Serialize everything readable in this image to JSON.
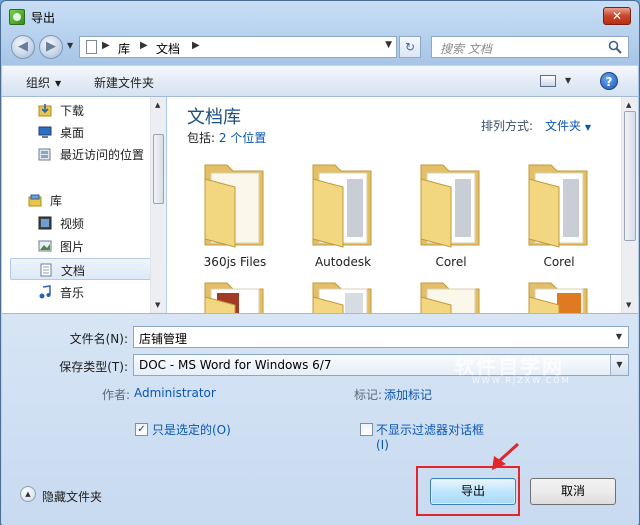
{
  "window": {
    "title": "导出",
    "close_label": "✕"
  },
  "address": {
    "crumbs": [
      "库",
      "文档"
    ]
  },
  "search": {
    "placeholder": "搜索 文档"
  },
  "toolbar": {
    "organize_label": "组织",
    "new_folder_label": "新建文件夹"
  },
  "sidebar": {
    "items": [
      {
        "label": "下载",
        "icon": "download-folder-icon"
      },
      {
        "label": "桌面",
        "icon": "desktop-icon"
      },
      {
        "label": "最近访问的位置",
        "icon": "recent-places-icon"
      },
      {
        "label": "库",
        "icon": "library-icon"
      },
      {
        "label": "视频",
        "icon": "video-icon"
      },
      {
        "label": "图片",
        "icon": "pictures-icon"
      },
      {
        "label": "文档",
        "icon": "documents-icon",
        "selected": true
      },
      {
        "label": "音乐",
        "icon": "music-icon"
      }
    ]
  },
  "library": {
    "title": "文档库",
    "includes_label": "包括:",
    "includes_link": "2 个位置",
    "arrange_label": "排列方式:",
    "arrange_value": "文件夹"
  },
  "folders": [
    {
      "name": "360js Files"
    },
    {
      "name": "Autodesk"
    },
    {
      "name": "Corel"
    },
    {
      "name": "Corel"
    }
  ],
  "form": {
    "filename_label": "文件名(N):",
    "filename_value": "店铺管理",
    "filetype_label": "保存类型(T):",
    "filetype_value": "DOC - MS Word for Windows 6/7",
    "author_label": "作者:",
    "author_value": "Administrator",
    "tags_label": "标记:",
    "tags_value": "添加标记",
    "selected_only_label": "只是选定的(O)",
    "selected_only_checked": true,
    "no_filter_dialog_label_line1": "不显示过滤器对话框",
    "no_filter_dialog_label_line2": "(I)",
    "no_filter_dialog_checked": false,
    "hide_folders_label": "隐藏文件夹",
    "export_button": "导出",
    "cancel_button": "取消"
  },
  "watermark": {
    "text": "软件自学网",
    "subtext": "WWW.RJZXW.COM"
  },
  "colors": {
    "accent": "#0b56b0",
    "highlight_box": "#e0262a",
    "title_blue": "#1c5180"
  }
}
